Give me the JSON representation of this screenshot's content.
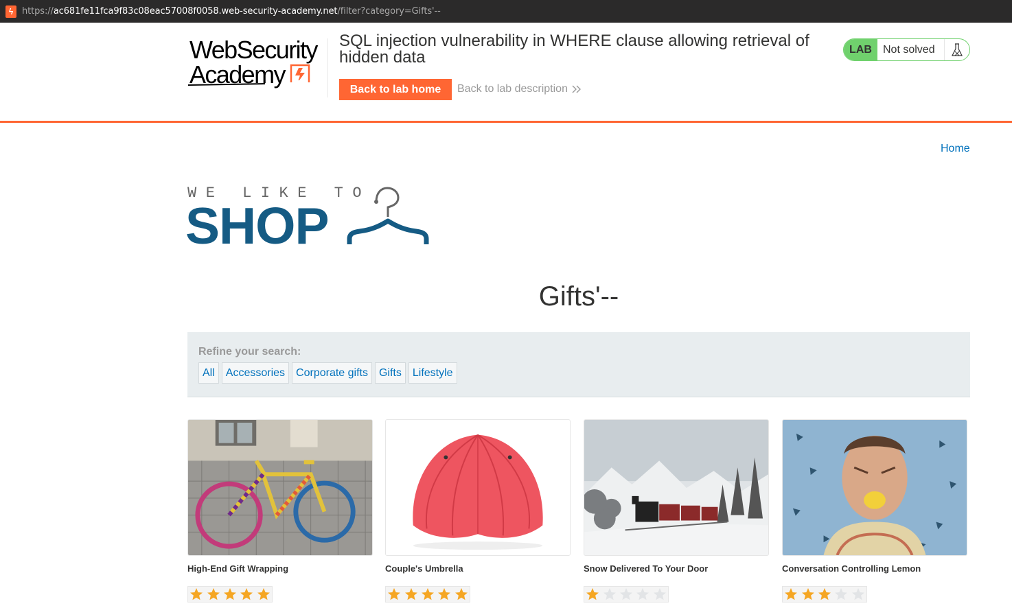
{
  "urlbar": {
    "scheme": "https://",
    "host": "ac681fe11fca9f83c08eac57008f0058.web-security-academy.net",
    "path": "/filter?category=Gifts'--"
  },
  "academy": {
    "logo_line1": "WebSecurity",
    "logo_line2": "Academy",
    "lab_title": "SQL injection vulnerability in WHERE clause allowing retrieval of hidden data",
    "back_home_label": "Back to lab home",
    "back_desc_label": "Back to lab description",
    "status_badge": "LAB",
    "status_text": "Not solved",
    "accent": "#ff6633",
    "status_color": "#70d16d"
  },
  "shop": {
    "home_link": "Home",
    "logo_tagline": "WE LIKE TO",
    "logo_word": "SHOP",
    "category_title": "Gifts'--",
    "refine_label": "Refine your search:",
    "filters": [
      "All",
      "Accessories",
      "Corporate gifts",
      "Gifts",
      "Lifestyle"
    ],
    "products": [
      {
        "name": "High-End Gift Wrapping",
        "rating": 5,
        "image": "yarn-bombed-bicycle"
      },
      {
        "name": "Couple's Umbrella",
        "rating": 5,
        "image": "red-umbrella"
      },
      {
        "name": "Snow Delivered To Your Door",
        "rating": 1,
        "image": "snowy-steam-train"
      },
      {
        "name": "Conversation Controlling Lemon",
        "rating": 3,
        "image": "man-biting-lemon"
      }
    ]
  }
}
